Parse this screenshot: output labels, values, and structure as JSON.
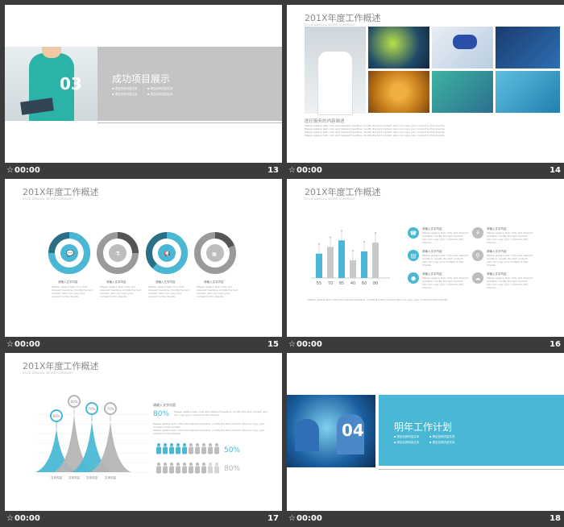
{
  "slides": [
    {
      "num": "13",
      "time": "00:00",
      "title": "成功项目展示",
      "badge": "03",
      "bullets": [
        "项目名称内容文本",
        "项目名称内容文本",
        "项目名称内容文本",
        "项目名称内容文本"
      ]
    },
    {
      "num": "14",
      "time": "00:00",
      "title": "201X年度工作概述",
      "subtitle": "201X ANNUAL WORK SUMMARY",
      "heading": "医疗服务的内容阐述"
    },
    {
      "num": "15",
      "time": "00:00",
      "title": "201X年度工作概述",
      "subtitle": "201X ANNUAL WORK SUMMARY",
      "items": [
        "请输入文字内容",
        "请输入文字内容",
        "请输入文字内容",
        "请输入文字内容"
      ]
    },
    {
      "num": "16",
      "time": "00:00",
      "title": "201X年度工作概述",
      "subtitle": "201X ANNUAL WORK SUMMARY",
      "features": [
        "请输入文字内容",
        "请输入文字内容",
        "请输入文字内容",
        "请输入文字内容",
        "请输入文字内容",
        "请输入文字内容"
      ],
      "chart_data": {
        "type": "bar",
        "categories": [
          "55",
          "70",
          "85",
          "40",
          "60",
          "80"
        ],
        "values": [
          55,
          70,
          85,
          40,
          60,
          80
        ],
        "colors": [
          "#4ab8d4",
          "#c9c9c9",
          "#4ab8d4",
          "#c9c9c9",
          "#4ab8d4",
          "#c9c9c9"
        ]
      }
    },
    {
      "num": "17",
      "time": "00:00",
      "title": "201X年度工作概述",
      "subtitle": "201X ANNUAL WORK SUMMARY",
      "heading": "请输入文字内容",
      "stat1": "80%",
      "stat2": "50%",
      "stat3": "80%",
      "chart_data": {
        "type": "area",
        "categories": [
          "文本内容",
          "文本内容",
          "文本内容",
          "文本内容"
        ],
        "values": [
          60,
          80,
          70,
          70
        ],
        "labels": [
          "60%",
          "80%",
          "70%",
          "70%"
        ],
        "colors": [
          "#4ab8d4",
          "#b5b5b5",
          "#4ab8d4",
          "#b5b5b5"
        ]
      }
    },
    {
      "num": "18",
      "time": "00:00",
      "title": "明年工作计划",
      "badge": "04",
      "bullets": [
        "项目名称内容文本",
        "项目名称内容文本",
        "项目名称内容文本",
        "项目名称内容文本"
      ]
    }
  ],
  "lorem": "Please replace text, click add relevant headline, modify the text content, also can copy your content to this directly."
}
